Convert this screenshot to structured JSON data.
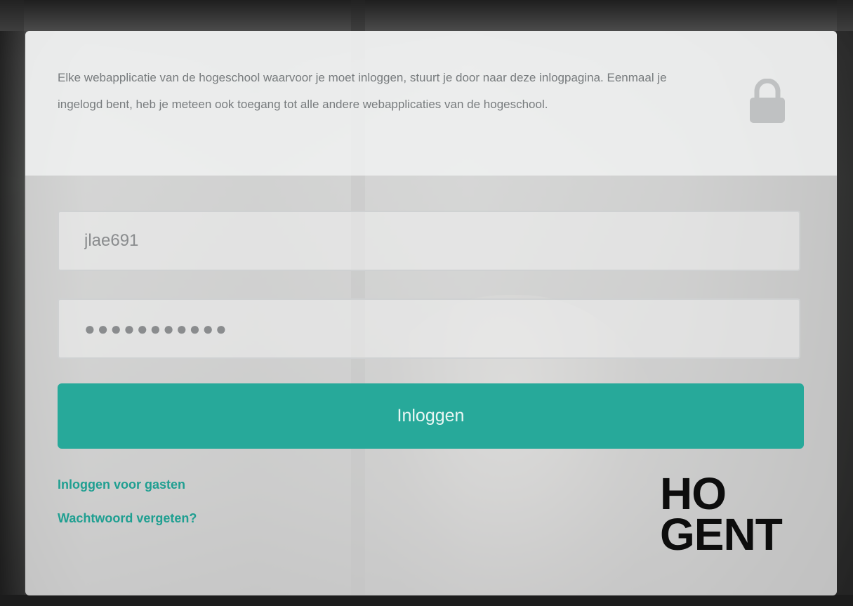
{
  "intro": {
    "text": "Elke webapplicatie van de hogeschool waarvoor je moet inloggen, stuurt je door naar deze inlogpagina. Eenmaal je ingelogd bent, heb je meteen ook toegang tot alle andere webapplicaties van de hogeschool."
  },
  "form": {
    "username_value": "jlae691",
    "password_value": "●●●●●●●●●●●",
    "submit_label": "Inloggen"
  },
  "links": {
    "guest_login": "Inloggen voor gasten",
    "forgot_password": "Wachtwoord vergeten?"
  },
  "logo": {
    "line1": "HO",
    "line2": "GENT"
  },
  "icons": {
    "lock": "lock-icon"
  },
  "colors": {
    "accent": "#27a99a",
    "link": "#1f9f91",
    "card_bg": "#e8e9e9",
    "text_muted": "#777b7d"
  }
}
